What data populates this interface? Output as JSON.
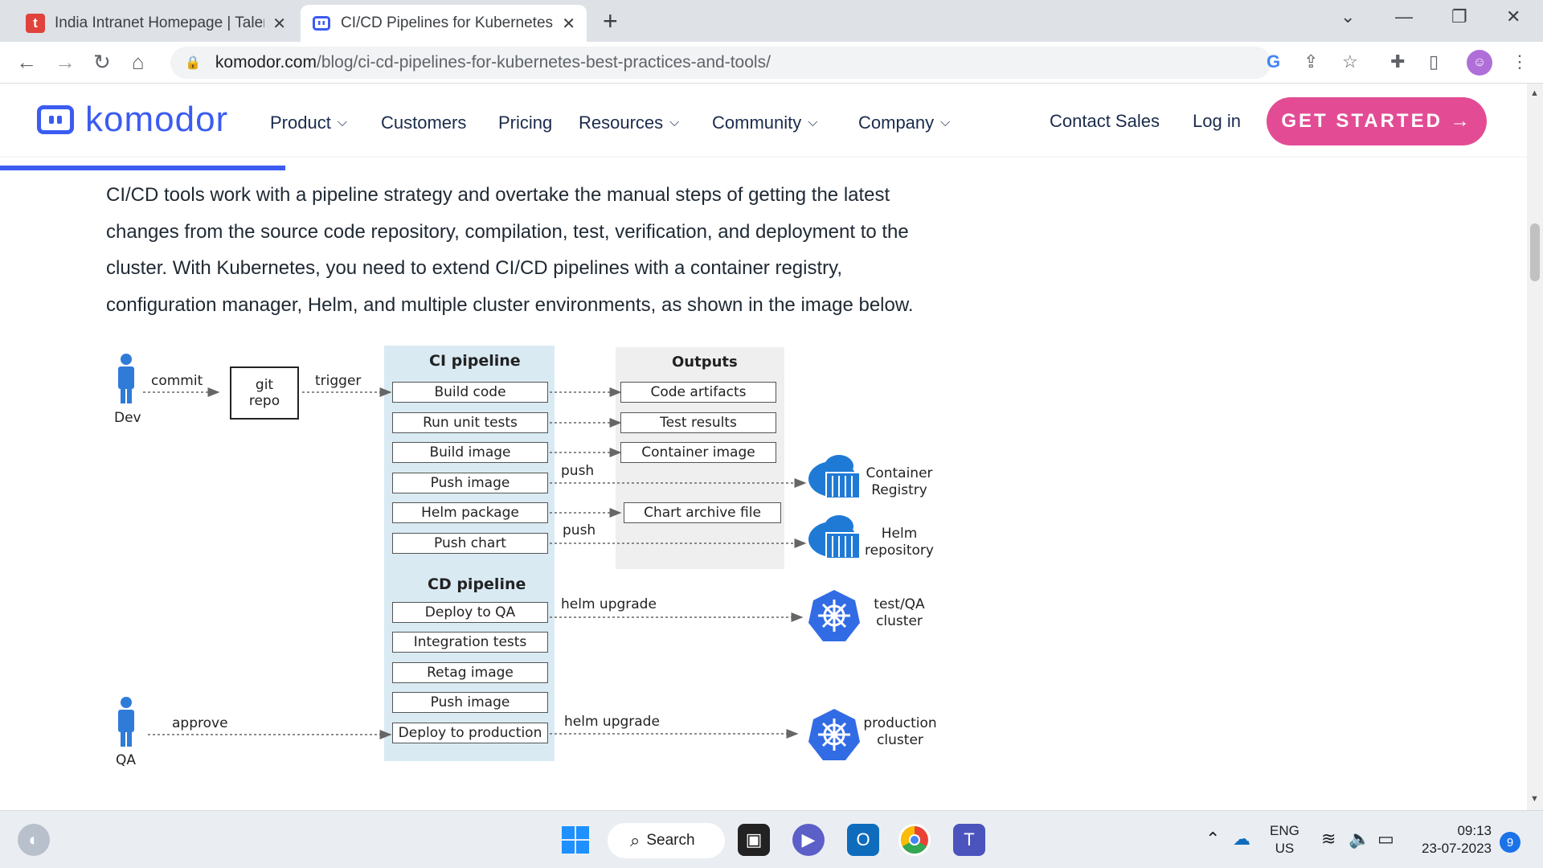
{
  "browser": {
    "tabs": [
      {
        "title": "India Intranet Homepage | Talent",
        "favicon": "t"
      },
      {
        "title": "CI/CD Pipelines for Kubernetes: B",
        "favicon": "komodor-icon"
      }
    ],
    "url_domain": "komodor.com",
    "url_path": "/blog/ci-cd-pipelines-for-kubernetes-best-practices-and-tools/"
  },
  "site": {
    "logo_text": "komodor",
    "menu": [
      "Product",
      "Customers",
      "Pricing",
      "Resources",
      "Community",
      "Company"
    ],
    "contact": "Contact Sales",
    "login": "Log in",
    "cta": "GET STARTED →",
    "brand_color": "#3b5cf0",
    "cta_color": "#e34c95"
  },
  "article": {
    "paragraph": "CI/CD tools work with a pipeline strategy and overtake the manual steps of getting the latest changes from the source code repository, compilation, test, verification, and deployment to the cluster. With Kubernetes, you need to extend CI/CD pipelines with a container registry, configuration manager, Helm, and multiple cluster environments, as shown in the image below."
  },
  "diagram": {
    "dev": "Dev",
    "qa": "QA",
    "commit": "commit",
    "git_repo_line1": "git",
    "git_repo_line2": "repo",
    "trigger": "trigger",
    "approve": "approve",
    "ci_title": "CI pipeline",
    "ci_steps": [
      "Build code",
      "Run unit tests",
      "Build image",
      "Push image",
      "Helm package",
      "Push chart"
    ],
    "outputs_title": "Outputs",
    "outputs": [
      "Code artifacts",
      "Test results",
      "Container image"
    ],
    "chart_archive": "Chart archive file",
    "push_label_1": "push",
    "push_label_2": "push",
    "container_registry": "Container Registry",
    "helm_repository": "Helm repository",
    "cd_title": "CD pipeline",
    "cd_steps": [
      "Deploy to QA",
      "Integration tests",
      "Retag image",
      "Push image",
      "Deploy to production"
    ],
    "helm_upgrade_1": "helm upgrade",
    "helm_upgrade_2": "helm upgrade",
    "qa_cluster": "test/QA cluster",
    "prod_cluster": "production cluster"
  },
  "taskbar": {
    "search": "Search",
    "lang_line1": "ENG",
    "lang_line2": "US",
    "time": "09:13",
    "date": "23-07-2023",
    "notifications": "9"
  }
}
